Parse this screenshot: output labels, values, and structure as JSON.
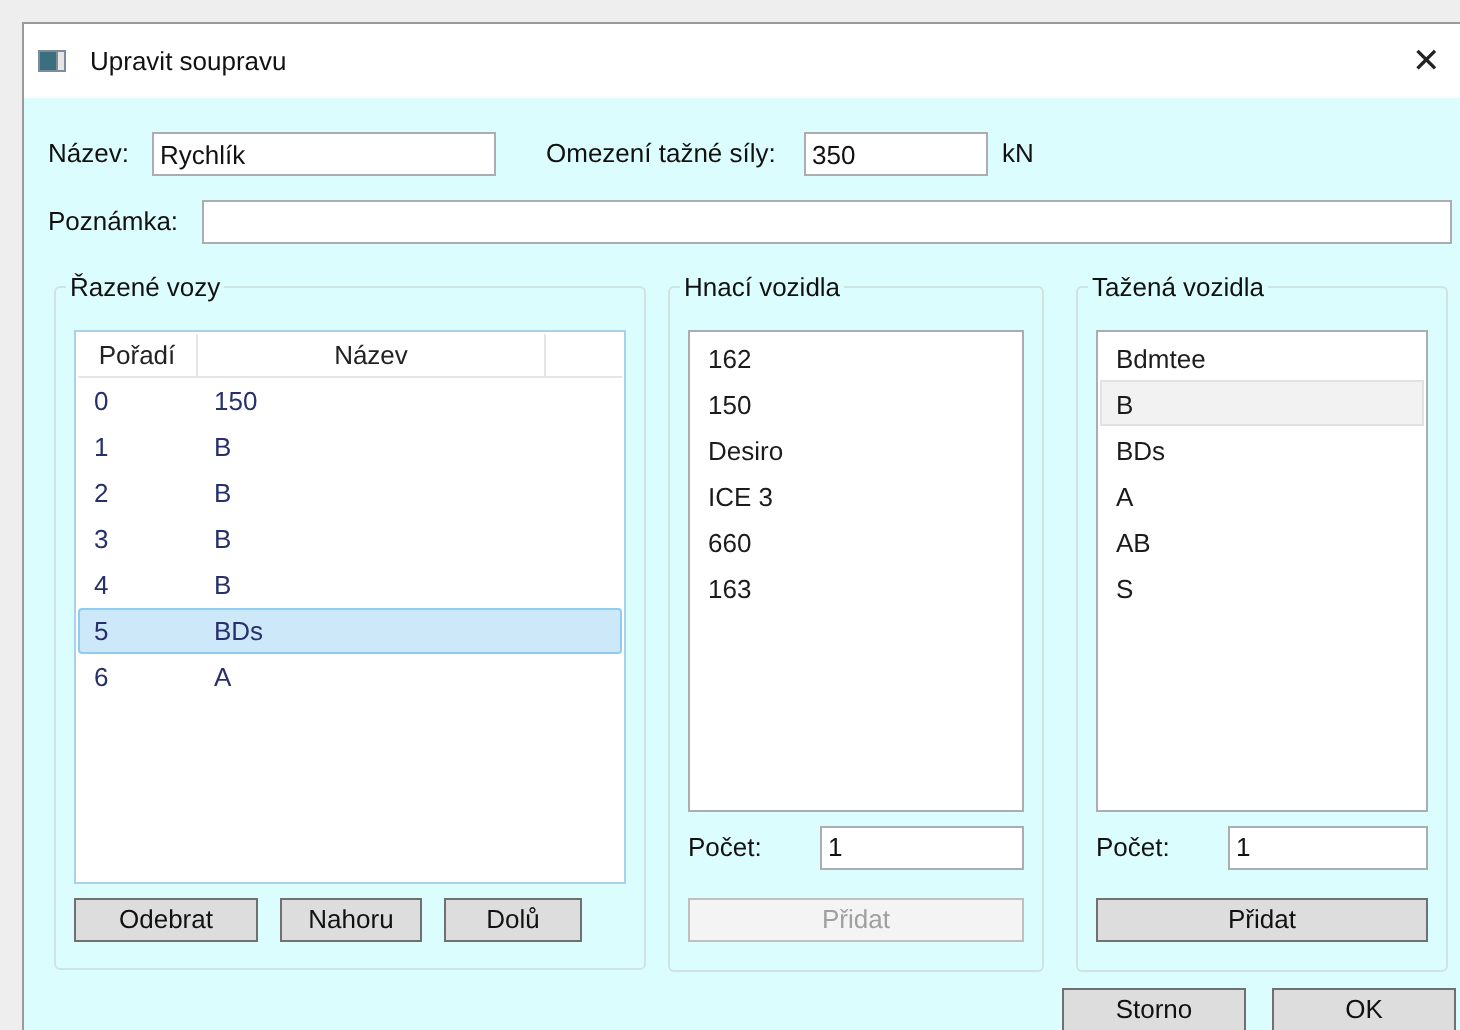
{
  "window": {
    "title": "Upravit soupravu",
    "close": "✕"
  },
  "form": {
    "name_label": "Název:",
    "name_value": "Rychlík",
    "force_label": "Omezení tažné síly:",
    "force_value": "350",
    "force_unit": "kN",
    "note_label": "Poznámka:"
  },
  "ordered_cars": {
    "title": "Řazené vozy",
    "columns": [
      "Pořadí",
      "Název"
    ],
    "rows": [
      {
        "order": "0",
        "name": "150",
        "selected": false
      },
      {
        "order": "1",
        "name": "B",
        "selected": false
      },
      {
        "order": "2",
        "name": "B",
        "selected": false
      },
      {
        "order": "3",
        "name": "B",
        "selected": false
      },
      {
        "order": "4",
        "name": "B",
        "selected": false
      },
      {
        "order": "5",
        "name": "BDs",
        "selected": true
      },
      {
        "order": "6",
        "name": "A",
        "selected": false
      }
    ],
    "buttons": [
      "Odebrat",
      "Nahoru",
      "Dolů"
    ]
  },
  "engines": {
    "title": "Hnací vozidla",
    "items": [
      {
        "label": "162",
        "selected": false
      },
      {
        "label": "150",
        "selected": false
      },
      {
        "label": "Desiro",
        "selected": false
      },
      {
        "label": "ICE 3",
        "selected": false
      },
      {
        "label": "660",
        "selected": false
      },
      {
        "label": "163",
        "selected": false
      }
    ],
    "count_label": "Počet:",
    "count_value": "1",
    "add_button": {
      "label": "Přidat",
      "disabled": true
    }
  },
  "cars": {
    "title": "Tažená vozidla",
    "items": [
      {
        "label": "Bdmtee",
        "selected": false
      },
      {
        "label": "B",
        "selected": true
      },
      {
        "label": "BDs",
        "selected": false
      },
      {
        "label": "A",
        "selected": false
      },
      {
        "label": "AB",
        "selected": false
      },
      {
        "label": "S",
        "selected": false
      }
    ],
    "count_label": "Počet:",
    "count_value": "1",
    "add_button": {
      "label": "Přidat",
      "disabled": false
    }
  },
  "buttons": [
    "Storno",
    "OK"
  ]
}
